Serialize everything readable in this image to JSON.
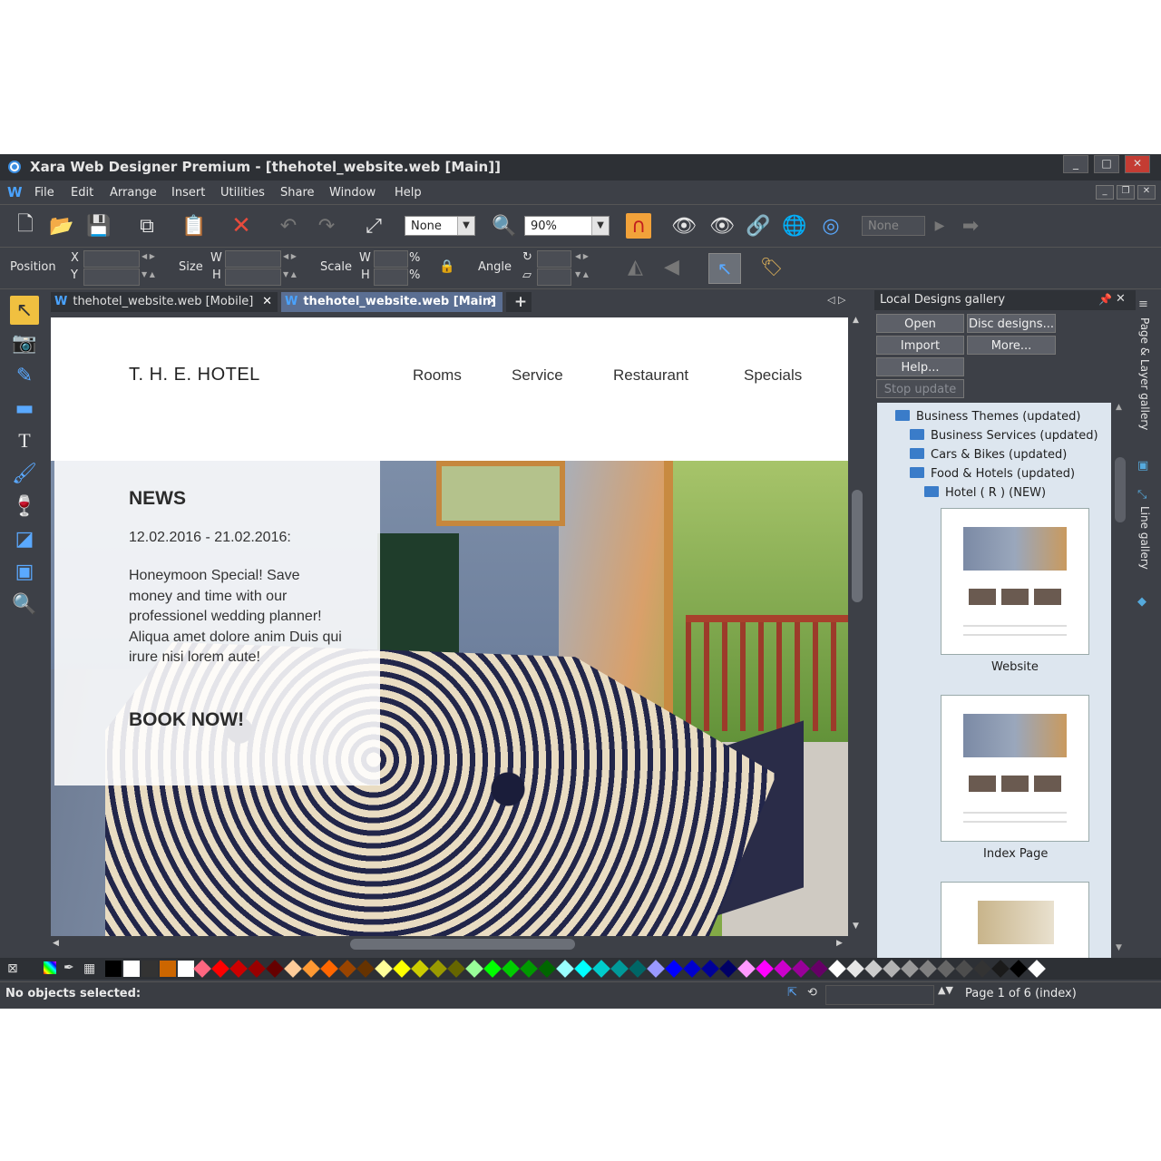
{
  "window": {
    "title": "Xara Web Designer Premium - [thehotel_website.web [Main]]",
    "controls": [
      "_",
      "□",
      "✕"
    ]
  },
  "menu": {
    "logo": "W",
    "items": [
      "File",
      "Edit",
      "Arrange",
      "Insert",
      "Utilities",
      "Share",
      "Window",
      "Help"
    ]
  },
  "toolbar": {
    "feather_value": "None",
    "zoom_value": "90%",
    "disabled_value": "None"
  },
  "infobar": {
    "position_label": "Position",
    "x_label": "X",
    "y_label": "Y",
    "size_label": "Size",
    "w_label": "W",
    "h_label": "H",
    "scale_label": "Scale",
    "percent": "%",
    "angle_label": "Angle"
  },
  "tabs": [
    {
      "icon": "W",
      "label": "thehotel_website.web [Mobile]",
      "close": "✕"
    },
    {
      "icon": "W",
      "label": "thehotel_website.web [Main]",
      "close": "✕"
    }
  ],
  "add_tab": "+",
  "site": {
    "brand": "T. H. E.  HOTEL",
    "nav": [
      "Rooms",
      "Service",
      "Restaurant",
      "Specials"
    ],
    "news_title": "NEWS",
    "news_date": "12.02.2016 - 21.02.2016:",
    "news_body": "Honeymoon Special! Save money and time with our professionel wedding planner! Aliqua amet dolore anim Duis qui irure nisi lorem aute!",
    "cta": "BOOK NOW!"
  },
  "gallery": {
    "title": "Local Designs gallery",
    "buttons": {
      "open": "Open",
      "disc": "Disc designs...",
      "import": "Import",
      "more": "More...",
      "help": "Help...",
      "stop": "Stop update"
    },
    "items": [
      "Business Themes (updated)",
      "Business Services (updated)",
      "Cars & Bikes (updated)",
      "Food & Hotels (updated)",
      "Hotel ( R ) (NEW)"
    ],
    "thumbs": [
      "Website",
      "Index Page"
    ]
  },
  "side_tabs": [
    "Page & Layer gallery",
    "Line gallery"
  ],
  "status": {
    "left": "No objects selected:",
    "page": "Page 1 of 6 (index)"
  },
  "palette_colors": [
    "#000000",
    "#ffffff",
    "#333333",
    "#cc6600",
    "#ffffff",
    "#ff6680",
    "#ff0000",
    "#cc0000",
    "#990000",
    "#660000",
    "#ffcc99",
    "#ff9933",
    "#ff6600",
    "#994400",
    "#663300",
    "#ffff99",
    "#ffff00",
    "#cccc00",
    "#999900",
    "#666600",
    "#99ff99",
    "#00ff00",
    "#00cc00",
    "#009900",
    "#006600",
    "#99ffff",
    "#00ffff",
    "#00cccc",
    "#009999",
    "#006666",
    "#9999ff",
    "#0000ff",
    "#0000cc",
    "#000099",
    "#000066",
    "#ff99ff",
    "#ff00ff",
    "#cc00cc",
    "#990099",
    "#660066",
    "#ffffff",
    "#e6e6e6",
    "#cccccc",
    "#b3b3b3",
    "#999999",
    "#808080",
    "#666666",
    "#4d4d4d",
    "#333333",
    "#1a1a1a",
    "#000000",
    "#ffffff"
  ]
}
